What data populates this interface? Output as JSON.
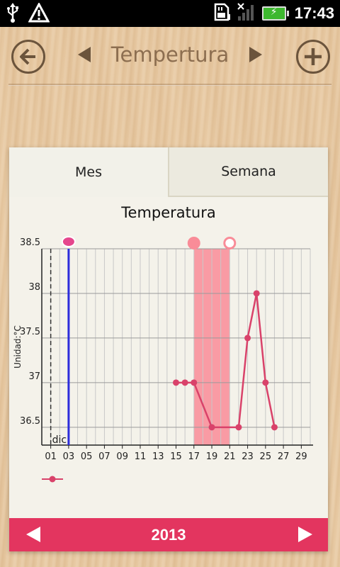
{
  "status_bar": {
    "time": "17:43",
    "icons": [
      "usb-icon",
      "warning-icon",
      "sd-card-icon",
      "signal-icon",
      "battery-charging-icon"
    ]
  },
  "header": {
    "title": "Tempertura",
    "back_icon": "back-arrow-icon",
    "prev_icon": "triangle-left-icon",
    "next_icon": "triangle-right-icon",
    "add_icon": "plus-icon"
  },
  "tabs": [
    {
      "label": "Mes",
      "active": true
    },
    {
      "label": "Semana",
      "active": false
    }
  ],
  "chart_data": {
    "type": "line",
    "title": "Temperatura",
    "ylabel": "Unidad:°C",
    "month_label": "dic",
    "ylim": [
      36.3,
      38.5
    ],
    "y_ticks": [
      "36.5",
      "37",
      "37.5",
      "38",
      "38.5"
    ],
    "x_ticks": [
      "01",
      "03",
      "05",
      "07",
      "09",
      "11",
      "13",
      "15",
      "17",
      "19",
      "21",
      "23",
      "25",
      "27",
      "29"
    ],
    "xlim": [
      0,
      30
    ],
    "series": [
      {
        "color": "#d9426a",
        "points": [
          [
            15,
            37.0
          ],
          [
            16,
            37.0
          ],
          [
            17,
            37.0
          ],
          [
            19,
            36.5
          ],
          [
            22,
            36.5
          ],
          [
            23,
            37.5
          ],
          [
            24,
            38.0
          ],
          [
            25,
            37.0
          ],
          [
            26,
            36.5
          ]
        ]
      }
    ],
    "highlight_range": [
      17,
      21
    ],
    "highlight_color": "#f98c98",
    "today_line_day": 3,
    "today_line_color": "#2c2cdb",
    "dashed_line_day": 1,
    "markers": [
      {
        "day": 3,
        "kind": "pill"
      },
      {
        "day": 17,
        "kind": "filled-circle"
      },
      {
        "day": 21,
        "kind": "ring"
      }
    ]
  },
  "footer": {
    "year": "2013"
  }
}
